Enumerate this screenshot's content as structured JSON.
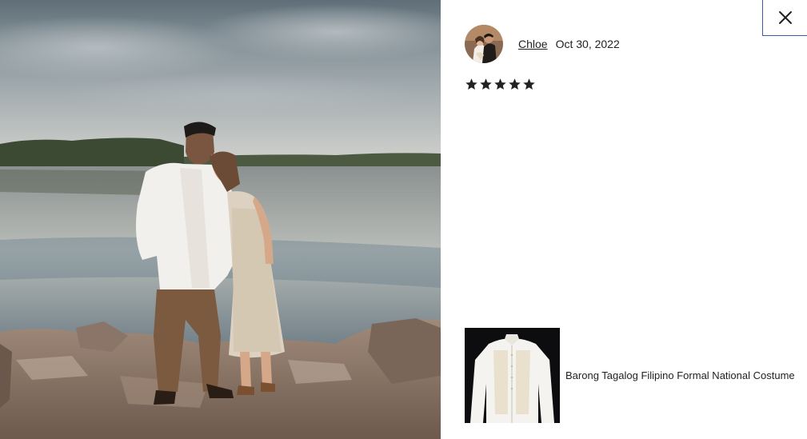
{
  "review": {
    "reviewer_name": "Chloe",
    "date": "Oct 30, 2022",
    "rating": 5,
    "stars": [
      "★",
      "★",
      "★",
      "★",
      "★"
    ]
  },
  "product": {
    "title": "Barong Tagalog Filipino Formal National Costume"
  },
  "icons": {
    "close": "close-icon",
    "star": "star-icon"
  },
  "colors": {
    "close_border": "#3b5ba9",
    "text": "#222222",
    "star": "#222222"
  }
}
